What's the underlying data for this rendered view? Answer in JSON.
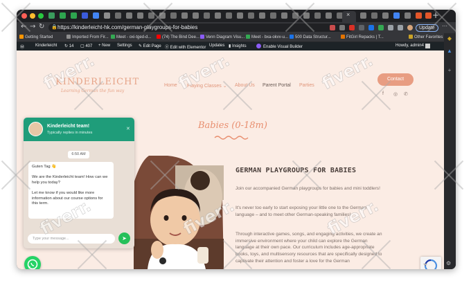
{
  "browser": {
    "new_tab_label": "+",
    "active_tab_close": "×",
    "url": "https://kinderleicht-hk.com/german-playgroups-for-babies",
    "update_button": "Update",
    "colors": {
      "chrome_dark": "#1f2023",
      "chrome": "#35363a",
      "accent": "#8ab4f8"
    },
    "bookmarks": [
      "Getting Started",
      "Imported From Fir...",
      "Meet - oxi-tged-d...",
      "(74) The Bind Dee...",
      "Venn Diagram Visu...",
      "Meet - bxa-okvv-u...",
      "500 Data Structur...",
      "FitGirl Repacks | T..."
    ],
    "other_favorites": "Other Favorites"
  },
  "admin_bar": {
    "items": [
      "Kinderleicht",
      "14",
      "407",
      "+ New",
      "Settings",
      "Edit Page",
      "Edit with Elementor",
      "Updates",
      "Insights",
      "Enable Visual Builder"
    ],
    "greeting": "Howdy, admin4"
  },
  "site": {
    "logo": "KINDERLEICHT",
    "logo_tagline": "Learning German the fun way",
    "nav": [
      "Home",
      "Playing Classes",
      "About Us",
      "Parent Portal",
      "Parties"
    ],
    "contact_button": "Contact",
    "social_icons": [
      "facebook-icon",
      "instagram-icon",
      "whatsapp-icon"
    ],
    "brand_color": "#e89d82",
    "section_title": "Babies (0-18m)",
    "heading": "GERMAN PLAYGROUPS FOR BABIES",
    "paragraphs": [
      "Join our accompanied German playgroups for babies and mini toddlers!",
      "It's never too early to start exposing your little one to the German language – and to meet other German-speaking families!",
      "Through interactive games, songs, and engaging activities, we create an immersive environment where your child can explore the German language at their own pace. Our curriculum includes age-appropriate books, toys, and multisensory resources that are specifically designed to captivate their attention and foster a love for the German"
    ]
  },
  "chat": {
    "name": "Kinderleicht team!",
    "subtitle": "Typically replies in minutes",
    "time": "6:50 AM",
    "messages": [
      "Guten Tag 👋",
      "We are the Kinderleicht team! How can we help you today?",
      "Let me know if you would like more information about our course options for this term."
    ],
    "input_placeholder": "Type your message...",
    "color": "#1f9d7a"
  },
  "watermark": "fiverr."
}
